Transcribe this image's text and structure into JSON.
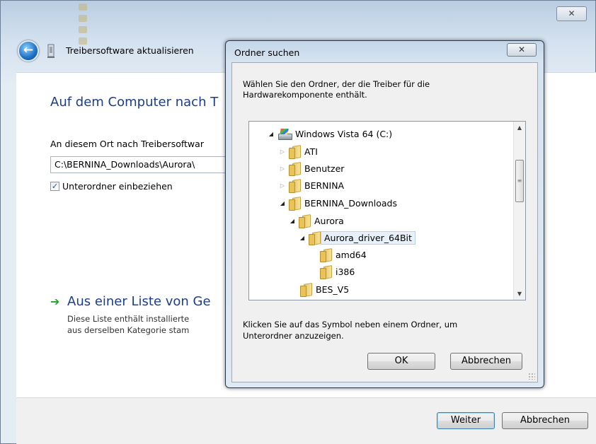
{
  "wizard": {
    "title": "Treibersoftware aktualisieren",
    "close_label": "✕",
    "back_label": "←",
    "heading": "Auf dem Computer nach T",
    "location_label": "An diesem Ort nach Treibersoftwar",
    "path_value": "C:\\BERNINA_Downloads\\Aurora\\",
    "include_subfolders_label": "Unterordner einbeziehen",
    "include_subfolders_checked": true,
    "list_option_title": "Aus einer Liste von Ge",
    "list_option_desc_line1": "Diese Liste enthält installierte",
    "list_option_desc_line2": "aus derselben Kategorie stam",
    "next_button": "Weiter",
    "cancel_button": "Abbrechen"
  },
  "dialog": {
    "title": "Ordner suchen",
    "close_label": "✕",
    "instruction": "Wählen Sie den Ordner, der die Treiber für die Hardwarekomponente enthält.",
    "tree": [
      {
        "label": "Windows Vista 64 (C:)",
        "icon": "drive-icon",
        "state": "open"
      },
      {
        "label": "ATI",
        "icon": "folder-icon",
        "state": "closed"
      },
      {
        "label": "Benutzer",
        "icon": "folder-icon",
        "state": "closed"
      },
      {
        "label": "BERNINA",
        "icon": "folder-icon",
        "state": "closed"
      },
      {
        "label": "BERNINA_Downloads",
        "icon": "folder-icon",
        "state": "open"
      },
      {
        "label": "Aurora",
        "icon": "folder-icon",
        "state": "open"
      },
      {
        "label": "Aurora_driver_64Bit",
        "icon": "folder-icon",
        "state": "open",
        "selected": true
      },
      {
        "label": "amd64",
        "icon": "folder-icon",
        "state": "none"
      },
      {
        "label": "i386",
        "icon": "folder-icon",
        "state": "none"
      },
      {
        "label": "BES_V5",
        "icon": "folder-icon",
        "state": "none"
      }
    ],
    "hint": "Klicken Sie auf das Symbol neben einem Ordner, um Unterordner anzuzeigen.",
    "ok_button": "OK",
    "cancel_button": "Abbrechen"
  }
}
